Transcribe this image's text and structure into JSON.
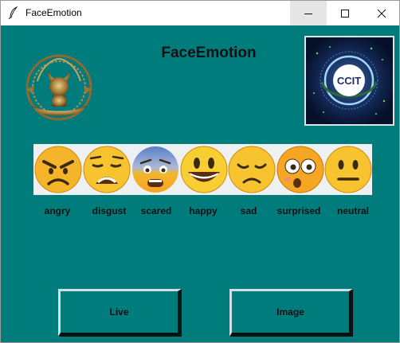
{
  "window": {
    "title": "FaceEmotion"
  },
  "colors": {
    "background": "#007c7c",
    "button": "#007c7c"
  },
  "app": {
    "title": "FaceEmotion"
  },
  "logo_right": {
    "text": "CCIT"
  },
  "emotions": [
    {
      "label": "angry",
      "icon": "angry-face-icon"
    },
    {
      "label": "disgust",
      "icon": "disgust-face-icon"
    },
    {
      "label": "scared",
      "icon": "scared-face-icon"
    },
    {
      "label": "happy",
      "icon": "happy-face-icon"
    },
    {
      "label": "sad",
      "icon": "sad-face-icon"
    },
    {
      "label": "surprised",
      "icon": "surprised-face-icon"
    },
    {
      "label": "neutral",
      "icon": "neutral-face-icon"
    }
  ],
  "buttons": {
    "live": "Live",
    "image": "Image"
  }
}
